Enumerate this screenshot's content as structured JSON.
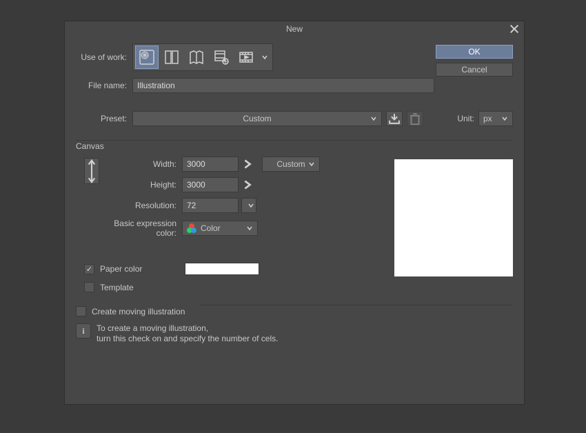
{
  "title": "New",
  "labels": {
    "use_of_work": "Use of work:",
    "file_name": "File name:",
    "preset": "Preset:",
    "unit": "Unit:"
  },
  "buttons": {
    "ok": "OK",
    "cancel": "Cancel"
  },
  "file_name_value": "Illustration",
  "preset_value": "Custom",
  "unit_value": "px",
  "canvas": {
    "legend": "Canvas",
    "width_label": "Width:",
    "width_value": "3000",
    "height_label": "Height:",
    "height_value": "3000",
    "size_preset": "Custom",
    "resolution_label": "Resolution:",
    "resolution_value": "72",
    "expr_label": "Basic expression color:",
    "expr_value": "Color",
    "paper_color_label": "Paper color",
    "paper_color_checked": true,
    "template_label": "Template",
    "template_checked": false
  },
  "moving": {
    "legend": "Create moving illustration",
    "checked": false,
    "info_line1": "To create a moving illustration,",
    "info_line2": "turn this check on and specify the number of cels."
  },
  "icons": {
    "illustration": "illustration-icon",
    "comic": "comic-icon",
    "book": "book-icon",
    "settings": "film-settings-icon",
    "animation": "animation-icon"
  }
}
